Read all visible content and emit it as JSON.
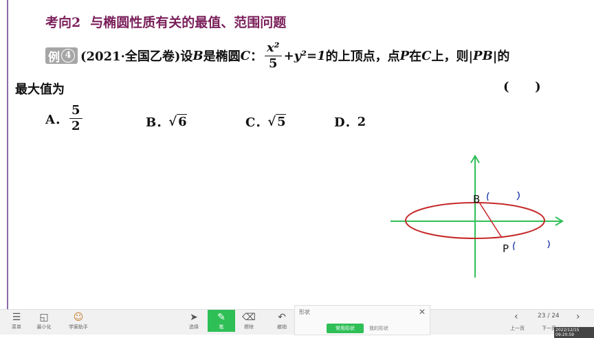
{
  "heading": {
    "part1": "考向2",
    "part2": "与椭圆性质有关的最值、范围问题"
  },
  "problem": {
    "badge": "例",
    "badge_num": "4",
    "source": "(2021·全国乙卷)设",
    "B1": "B",
    "text1": "是椭圆",
    "C1": "C",
    "colon": "：",
    "frac_num": "x²",
    "frac_den": "5",
    "eq_rest": "+y²=1",
    "text2": "的上顶点，点",
    "P": "P",
    "text3": "在",
    "C2": "C",
    "text4": "上，则|",
    "PB": "PB",
    "text5": "|的",
    "line2": "最大值为",
    "answer_paren": "(      )"
  },
  "options": {
    "a_label": "A．",
    "a_num": "5",
    "a_den": "2",
    "b_label": "B．",
    "b_val": "6",
    "c_label": "C．",
    "c_val": "5",
    "d_label": "D．",
    "d_val": "2"
  },
  "sketch": {
    "label_B": "B",
    "label_P": "P",
    "mark_B": "( )",
    "mark_P": "( )"
  },
  "toolbar": {
    "menu_label": "菜单",
    "minimize_label": "最小化",
    "assistant_label": "学案助手",
    "select_label": "选择",
    "pen_label": "笔",
    "eraser_label": "擦除",
    "undo_label": "撤销",
    "shape_panel_title": "形状",
    "shape_tab_common": "常用形状",
    "shape_tab_mine": "我的形状",
    "prev_label": "上一页",
    "page_indicator": "23 / 24",
    "next_label": "下一页",
    "timestamp": "2022/12/15 09:20:59"
  },
  "colors": {
    "title": "#7a1f5a",
    "axis": "#2fbf57",
    "ellipse": "#c62828",
    "pen_active": "#2fbf57",
    "handwriting": "#1f3aa8"
  }
}
